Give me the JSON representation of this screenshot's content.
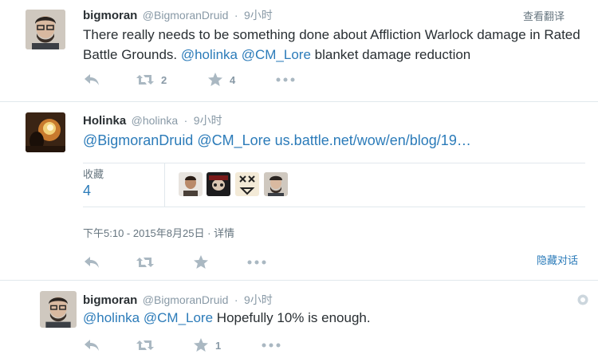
{
  "tweets": [
    {
      "name": "bigmoran",
      "handle": "@BigmoranDruid",
      "sep": "·",
      "time": "9小时",
      "view_translation": "查看翻译",
      "text_plain_1": "There really needs to be something done about Affliction Warlock damage in Rated Battle Grounds. ",
      "mention_1": "@holinka",
      "mention_2": "@CM_Lore",
      "text_plain_2": " blanket damage reduction",
      "retweets": "2",
      "favorites": "4"
    },
    {
      "name": "Holinka",
      "handle": "@holinka",
      "sep": "·",
      "time": "9小时",
      "mention_1": "@BigmoranDruid",
      "mention_2": "@CM_Lore",
      "link": "us.battle.net/wow/en/blog/19…",
      "fav_label": "收藏",
      "fav_count": "4",
      "date": "下午5:10 - 2015年8月25日",
      "date_sep": "·",
      "details": "详情",
      "hide_conversation": "隐藏对话"
    },
    {
      "name": "bigmoran",
      "handle": "@BigmoranDruid",
      "sep": "·",
      "time": "9小时",
      "mention_1": "@holinka",
      "mention_2": "@CM_Lore",
      "text_plain": " Hopefully 10% is enough.",
      "favorites": "1"
    }
  ],
  "icons": {
    "reply": "reply-icon",
    "retweet": "retweet-icon",
    "favorite": "star-icon",
    "more": "more-icon",
    "settings": "gear-icon"
  },
  "colors": {
    "link": "#2b7bb9",
    "muted": "#8899a6",
    "icon": "#aab8c2",
    "divider": "#e1e8ed"
  }
}
